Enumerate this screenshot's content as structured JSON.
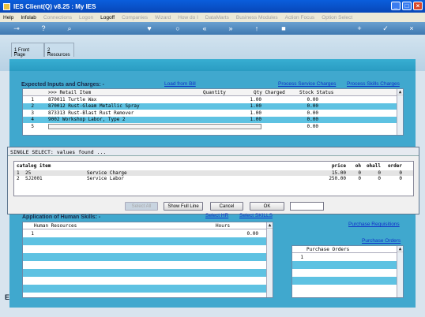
{
  "window": {
    "title": "IES Client(Q) v8.25 : My IES"
  },
  "menu": [
    {
      "label": "Help",
      "enabled": true
    },
    {
      "label": "Infolab",
      "enabled": true
    },
    {
      "label": "Connections",
      "enabled": false
    },
    {
      "label": "Logon",
      "enabled": false
    },
    {
      "label": "Logoff",
      "enabled": true
    },
    {
      "label": "Companies",
      "enabled": false
    },
    {
      "label": "Wizard",
      "enabled": false
    },
    {
      "label": "How do I",
      "enabled": false
    },
    {
      "label": "DataMarts",
      "enabled": false
    },
    {
      "label": "Business Modules",
      "enabled": false
    },
    {
      "label": "Action Focus",
      "enabled": false
    },
    {
      "label": "Option Select",
      "enabled": false
    }
  ],
  "tabs": [
    {
      "key": "1",
      "label": " Front Page"
    },
    {
      "key": "2",
      "label": " Resources"
    }
  ],
  "inputs_section": {
    "title": "Expected Inputs and Charges: -",
    "load_link": "Load from Bill",
    "service_link": "Process Service Charges",
    "skills_link": "Process Skills Charges",
    "columns": {
      "retail": ">>> Retail Item",
      "quantity": "Quantity",
      "qty_charged": "Qty Charged",
      "stock": "Stock Status"
    },
    "rows": [
      {
        "n": "1",
        "item": "870011 Turtle Wax",
        "qty": "1.00",
        "charged": "0.00"
      },
      {
        "n": "2",
        "item": "870012 Rust-Gleam Metallic Spray",
        "qty": "1.00",
        "charged": "0.00"
      },
      {
        "n": "3",
        "item": "873313 Rust-Blast Rust Remover",
        "qty": "1.00",
        "charged": "0.00"
      },
      {
        "n": "4",
        "item": "9002 Workshop Labor, Type 2",
        "qty": "1.00",
        "charged": "0.00"
      },
      {
        "n": "5",
        "item": "",
        "qty": "",
        "charged": "0.00"
      }
    ]
  },
  "dialog": {
    "title": "SINGLE SELECT: values found  ...",
    "columns": {
      "catalog": "catalog item",
      "price": "price",
      "oh": "oh",
      "ohall": "ohall",
      "order": "order"
    },
    "rows": [
      {
        "n": "1",
        "code": "25",
        "name": "Service Charge",
        "price": "15.00",
        "oh": "0",
        "ohall": "0",
        "order": "0"
      },
      {
        "n": "2",
        "code": "SJ2001",
        "name": "Service Labor",
        "price": "250.00",
        "oh": "0",
        "ohall": "0",
        "order": "0"
      }
    ],
    "buttons": {
      "select_all": "Select All",
      "full_line": "Show Full Line",
      "cancel": "Cancel",
      "ok": "OK"
    },
    "search_value": ""
  },
  "skills_section": {
    "title": "Application of Human Skills: -",
    "select_hr": "Select HR",
    "select_skills": "Select SKILLS",
    "columns": {
      "hr": "Human Resources",
      "hours": "Hours"
    },
    "rows": [
      {
        "n": "1",
        "hr": "",
        "hours": "0.00"
      }
    ]
  },
  "purchase": {
    "requisitions_link": "Purchase Requisitions",
    "orders_link": "Purchase Orders",
    "column": "Purchase Orders",
    "rows": [
      {
        "n": "1",
        "po": ""
      }
    ]
  },
  "colors": {
    "accent": "#40a8ce",
    "row_alt": "#5ec2e2",
    "link": "#1030c8"
  }
}
